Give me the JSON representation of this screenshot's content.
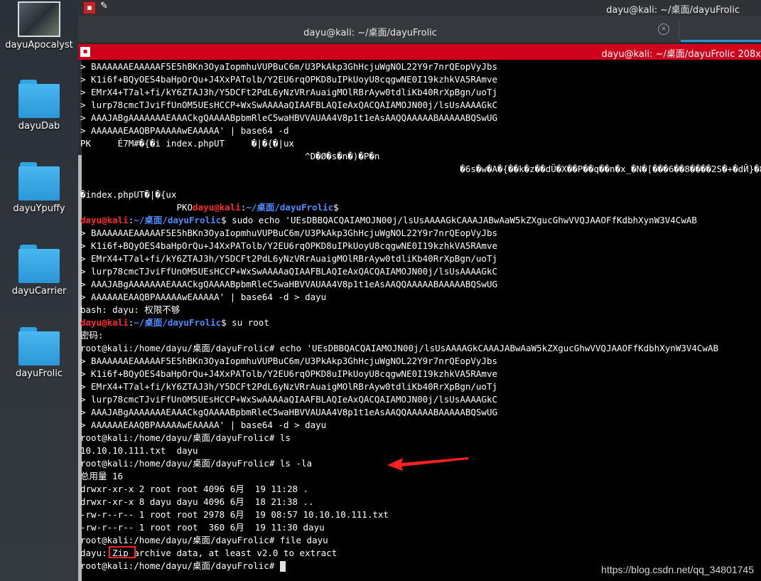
{
  "window": {
    "topbar_title": "dayu@kali: ~/桌面/dayuFrolic",
    "tab_title": "dayu@kali: ~/桌面/dayuFrolic",
    "pane_title": "dayu@kali: ~/桌面/dayuFrolic 208x"
  },
  "desktop": {
    "items": [
      {
        "label": "dayuApocalyst",
        "icon": "image-thumbnail"
      },
      {
        "label": "dayuDab",
        "icon": "folder-icon"
      },
      {
        "label": "dayuYpuffy",
        "icon": "folder-icon"
      },
      {
        "label": "dayuCarrier",
        "icon": "folder-icon"
      },
      {
        "label": "dayuFrolic",
        "icon": "folder-icon"
      }
    ]
  },
  "terminal": {
    "prompt_user": "dayu@kali",
    "prompt_path": "~/桌面/dayuFrolic",
    "root_prompt": "root@kali:/home/dayu/桌面/dayuFrolic#",
    "lines": [
      "> BAAAAAAEAAAAAF5E5hBKn3OyaIopmhuVUPBuC6m/U3PkAkp3GhHcjuWgNOL22Y9r7nrQEopVyJbs",
      "> K1i6f+BQyOES4baHpOrQu+J4XxPATolb/Y2EU6rqOPKD8uIPkUoyU8cqgwNE0I19kzhkVA5RAmve",
      "> EMrX4+T7al+fi/kY6ZTAJ3h/Y5DCFt2PdL6yNzVRrAuaigMOlRBrAyw0tdliKb40RrXpBgn/uoTj",
      "> lurp78cmcTJviFfUnOM5UEsHCCP+WxSwAAAAaQIAAFBLAQIeAxQACQAIAMOJN00j/lsUsAAAAGkC",
      "> AAAJABgAAAAAAAEAAACkgQAAAABpbmRleC5waHBVVAUAA4V8p1t1eAsAAQQAAAAABAAAAABQSwUG",
      "> AAAAAAEAAQBPAAAAAwEAAAAA' | base64 -d",
      "PK     É7M#�{�i index.phpUT     �|�{�|ux",
      "                                          ^D�Ø�s�n�)�P�n",
      "                                                                       �6s�w�A�{��k�z��dÜ�X��P��q��n�x_�N�[���6��8����2S�+�dЙ}�8dTQ",
      "",
      "�index.phpUT�|�{ux",
      "                  PKO"
    ],
    "cmd_echo": "sudo echo 'UEsDBBQACQAIAMOJN00j/lsUsAAAAGkCAAAJABwAaW5kZXgucGhwVVQJAAOFfKdbhXynW3V4CwAB",
    "cont_lines": [
      "> BAAAAAAEAAAAAF5E5hBKn3OyaIopmhuVUPBuC6m/U3PkAkp3GhHcjuWgNOL22Y9r7nrQEopVyJbs",
      "> K1i6f+BQyOES4baHpOrQu+J4XxPATolb/Y2EU6rqOPKD8uIPkUoyU8cqgwNE0I19kzhkVA5RAmve",
      "> EMrX4+T7al+fi/kY6ZTAJ3h/Y5DCFt2PdL6yNzVRrAuaigMOlRBrAyw0tdliKb40RrXpBgn/uoTj",
      "> lurp78cmcTJviFfUnOM5UEsHCCP+WxSwAAAAaQIAAFBLAQIeAxQACQAIAMOJN00j/lsUsAAAAGkC",
      "> AAAJABgAAAAAAAEAAACkgQAAAABpbmRleC5waHBVVAUAA4V8p1t1eAsAAQQAAAAABAAAAABQSwUG"
    ],
    "last_cont_redirect": "> AAAAAAEAAQBPAAAAAwEAAAAA' | base64 -d > dayu",
    "bash_error": "bash: dayu: 权限不够",
    "cmd_su": "su root",
    "password_prompt": "密码:",
    "root_cmd_echo": "echo 'UEsDBBQACQAIAMOJN00j/lsUsAAAAGkCAAAJABwAaW5kZXgucGhwVVQJAAOFfKdbhXynW3V4CwAB",
    "cmd_ls": "ls",
    "ls_output": "10.10.10.111.txt  dayu",
    "cmd_ls_la": "ls -la",
    "total": "总用量 16",
    "listing": [
      "drwxr-xr-x 2 root root 4096 6月  19 11:28 .",
      "drwxr-xr-x 8 dayu dayu 4096 6月  18 21:38 ..",
      "-rw-r--r-- 1 root root 2978 6月  19 08:57 10.10.10.111.txt",
      "-rw-r--r-- 1 root root  360 6月  19 11:30 dayu"
    ],
    "cmd_file": "file dayu",
    "file_prefix": "dayu: ",
    "file_zip": "Zip",
    "file_rest": " archive data, at least v2.0 to extract"
  },
  "watermark": "https://blog.csdn.net/qq_34801745",
  "colors": {
    "user": "#ff2a2a",
    "path": "#4d8cff",
    "title_bar": "#d0021b",
    "annotation": "#ff2020"
  }
}
